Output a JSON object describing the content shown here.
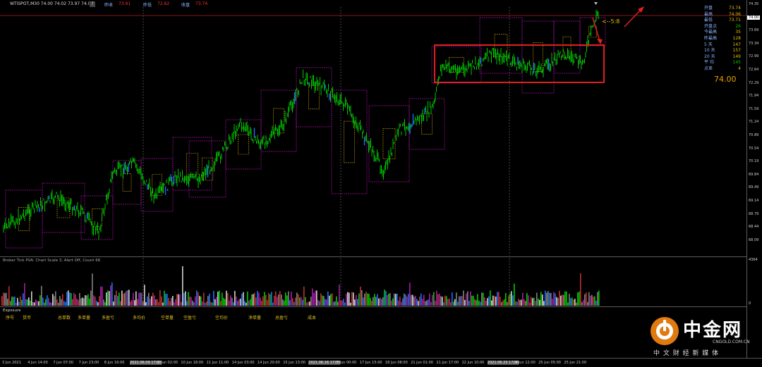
{
  "header": {
    "symbol_ohlc": "WTISPOT,M30  74.00 74.02 73.97 74.00",
    "icon_q": "?",
    "prev_close_label": "昨收",
    "prev_close_value": "73.91",
    "prev_low_label": "昨低",
    "prev_low_value": "72.62",
    "today_close_label": "收盘",
    "today_close_value": "73.74"
  },
  "price_axis": {
    "ticks": [
      "74.35",
      "74.00",
      "73.69",
      "73.34",
      "72.99",
      "72.64",
      "72.29",
      "71.94",
      "71.59",
      "71.24",
      "70.89",
      "70.54",
      "70.19",
      "69.84",
      "69.49",
      "69.14",
      "68.79",
      "68.44",
      "68.09"
    ],
    "current_price_tag": "74.00"
  },
  "stats_panel": {
    "rows": [
      {
        "label": "开盘",
        "value": "73.74",
        "color": "#e8c000"
      },
      {
        "label": "最高",
        "value": "74.06",
        "color": "#e8c000"
      },
      {
        "label": "最低",
        "value": "73.71",
        "color": "#e8c000"
      },
      {
        "label": "开盘点",
        "value": "26",
        "color": "#00cc00"
      },
      {
        "label": "今最高",
        "value": "35",
        "color": "#e8c000"
      },
      {
        "label": "昨最高",
        "value": "128",
        "color": "#e8c000"
      },
      {
        "label": "5 天",
        "value": "147",
        "color": "#e8c000"
      },
      {
        "label": "10 天",
        "value": "157",
        "color": "#e8c000"
      },
      {
        "label": "20 天",
        "value": "149",
        "color": "#e8c000"
      },
      {
        "label": "平 均",
        "value": "145",
        "color": "#00cc00"
      },
      {
        "label": "点差",
        "value": "4",
        "color": "#e8c000"
      }
    ],
    "big_price": "74.00"
  },
  "annotation": {
    "ratio_label": "<--5:8"
  },
  "indicator_panel": {
    "title": "Broker Tick PVA:  Chart Scale 3, Alert Off,  Count  66",
    "axis_top": "4364",
    "axis_bottom": "0"
  },
  "exposure_panel": {
    "title": "Exposure",
    "columns": [
      "序号",
      "货币",
      "总单数",
      "多单量",
      "多盈亏",
      "多均价",
      "空单量",
      "空盈亏",
      "空均价",
      "净单量",
      "总盈亏",
      "成本"
    ]
  },
  "time_axis": {
    "labels": [
      "3 Jun 2021",
      "4 Jun 14:00",
      "7 Jun 07:00",
      "7 Jun 23:00",
      "8 Jun 16:00",
      "2021.06.09 17:30",
      "10 Jun 02:00",
      "10 Jun 18:00",
      "11 Jun 11:00",
      "14 Jun 03:00",
      "14 Jun 20:00",
      "15 Jun 13:00",
      "2021.06.16 17:30",
      "17 Jun 00:00",
      "17 Jun 15:00",
      "18 Jun 08:00",
      "21 Jun 01:00",
      "21 Jun 17:00",
      "22 Jun 10:00",
      "2021.06.23 17:30",
      "24 Jun 12:00",
      "25 Jun 05:00",
      "25 Jun 21:00"
    ]
  },
  "watermark": {
    "name": "中金网",
    "url": "CNGOLD.COM.CN",
    "slogan": "中 文 财 经 新 媒 体"
  },
  "colors": {
    "candle_up": "#00c800",
    "candle_down": "#00c800",
    "highlight_bar": "#1e6eff",
    "box_magenta": "#a010a0",
    "box_yellow": "#c8a800",
    "annotation_red": "#e02020",
    "grid": "#333333"
  }
}
